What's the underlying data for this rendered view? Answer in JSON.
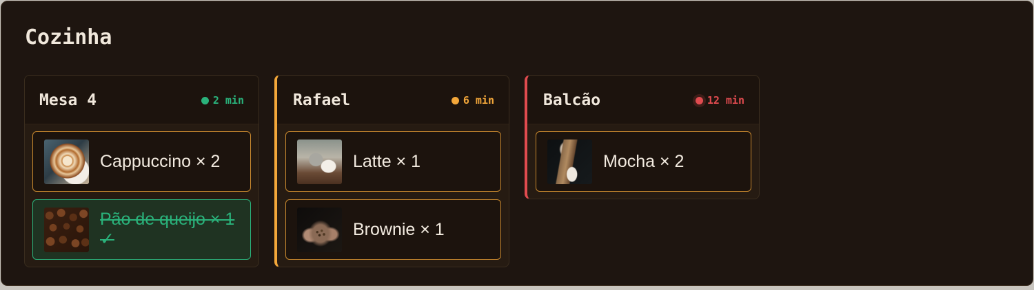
{
  "page": {
    "title": "Cozinha"
  },
  "colors": {
    "green": "#2ab27b",
    "amber": "#f3a73a",
    "red": "#e04b4f",
    "item_border": "#c8882e",
    "background": "#1e1510"
  },
  "tickets": [
    {
      "name": "Mesa 4",
      "timer": "2 min",
      "status": "green",
      "items": [
        {
          "label": "Cappuccino × 2",
          "thumbnail": "cappuccino-photo",
          "done": false
        },
        {
          "label": "Pão de queijo × 1 ✓",
          "thumbnail": "coffee-beans-photo",
          "done": true
        }
      ]
    },
    {
      "name": "Rafael",
      "timer": "6 min",
      "status": "amber",
      "items": [
        {
          "label": "Latte × 1",
          "thumbnail": "latte-photo",
          "done": false
        },
        {
          "label": "Brownie × 1",
          "thumbnail": "beans-in-hands-photo",
          "done": false
        }
      ]
    },
    {
      "name": "Balcão",
      "timer": "12 min",
      "status": "red",
      "items": [
        {
          "label": "Mocha × 2",
          "thumbnail": "mocha-pour-photo",
          "done": false
        }
      ]
    }
  ]
}
